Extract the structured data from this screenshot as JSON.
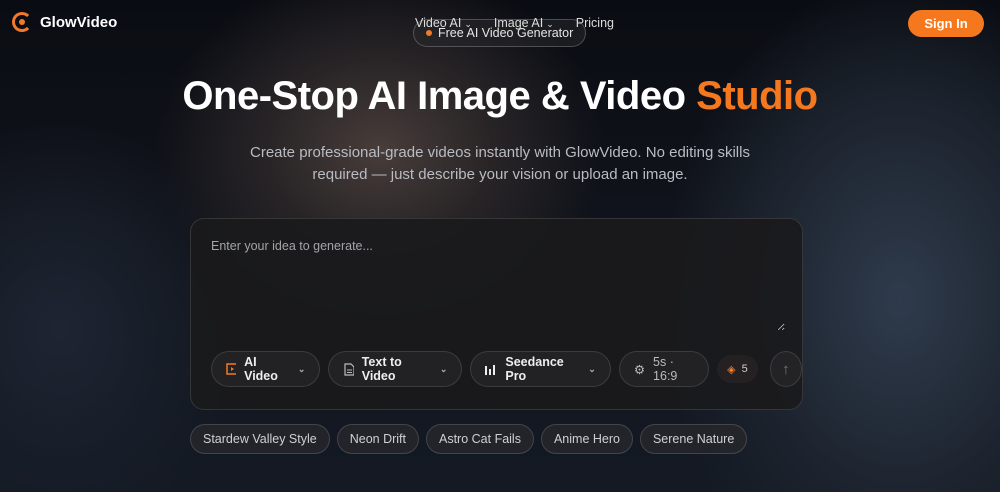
{
  "brand": {
    "name": "GlowVideo",
    "accent": "#f5781f"
  },
  "nav": {
    "items": [
      {
        "label": "Video AI",
        "dropdown": true
      },
      {
        "label": "Image AI",
        "dropdown": true
      },
      {
        "label": "Pricing",
        "dropdown": false
      }
    ],
    "sign_in": "Sign In"
  },
  "badge": "Free AI Video Generator",
  "hero": {
    "title": "One-Stop AI Image & Video",
    "title_accent": "Studio",
    "subtitle": "Create professional-grade videos instantly with GlowVideo. No editing skills required — just describe your vision or upload an image."
  },
  "prompt": {
    "placeholder": "Enter your idea to generate...",
    "value": ""
  },
  "toolbar": {
    "mode": "AI Video",
    "type": "Text to Video",
    "model": "Seedance Pro",
    "settings": "5s · 16:9",
    "credits": "5"
  },
  "chips": [
    "Stardew Valley Style",
    "Neon Drift",
    "Astro Cat Fails",
    "Anime Hero",
    "Serene Nature"
  ]
}
